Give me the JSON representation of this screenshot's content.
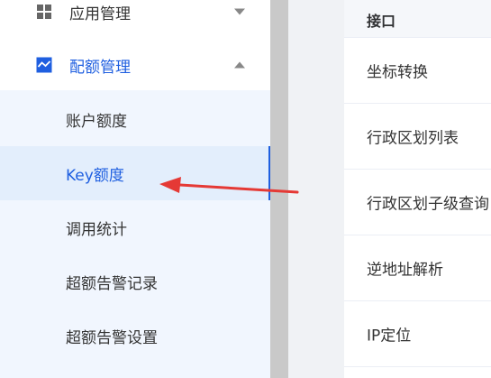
{
  "sidebar": {
    "app_mgmt_label": "应用管理",
    "quota_mgmt_label": "配额管理",
    "sub_items": [
      "账户额度",
      "Key额度",
      "调用统计",
      "超额告警记录",
      "超额告警设置"
    ]
  },
  "table": {
    "header": "接口",
    "rows": [
      "坐标转换",
      "行政区划列表",
      "行政区划子级查询",
      "逆地址解析",
      "IP定位"
    ]
  },
  "colors": {
    "accent": "#1f5fe0",
    "annotation": "#e53935"
  }
}
